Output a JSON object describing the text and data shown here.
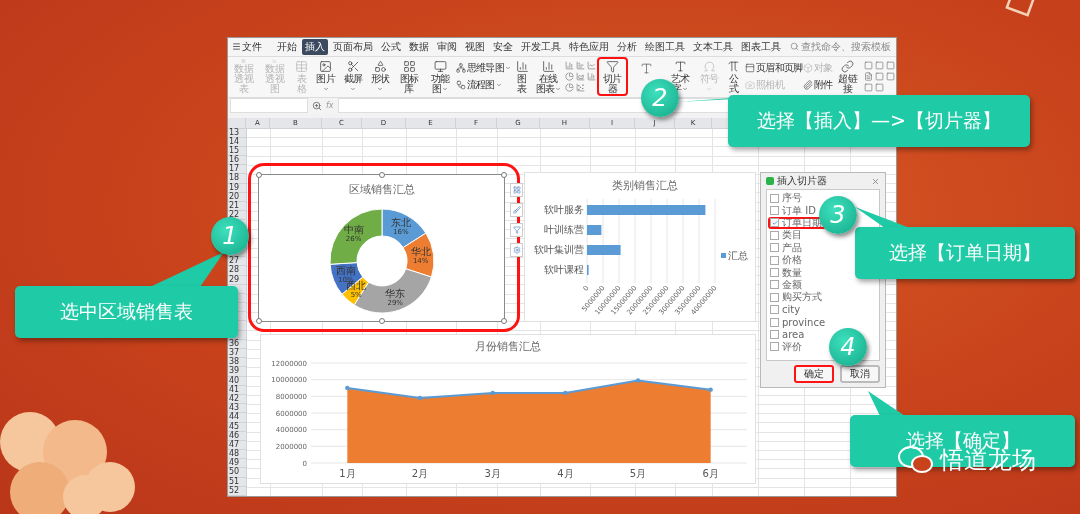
{
  "app": {
    "menu_label": "文件",
    "tabs": [
      {
        "label": "开始",
        "selected": false
      },
      {
        "label": "插入",
        "selected": true
      },
      {
        "label": "页面布局",
        "selected": false
      },
      {
        "label": "公式",
        "selected": false
      },
      {
        "label": "数据",
        "selected": false
      },
      {
        "label": "审阅",
        "selected": false
      },
      {
        "label": "视图",
        "selected": false
      },
      {
        "label": "安全",
        "selected": false
      },
      {
        "label": "开发工具",
        "selected": false
      },
      {
        "label": "特色应用",
        "selected": false
      },
      {
        "label": "分析",
        "selected": false
      },
      {
        "label": "绘图工具",
        "selected": false
      },
      {
        "label": "文本工具",
        "selected": false
      },
      {
        "label": "图表工具",
        "selected": false
      }
    ],
    "search": {
      "placeholder": "查找命令、搜索模板"
    },
    "ribbon": [
      {
        "kind": "large",
        "label": "数据透视表",
        "disabled": true,
        "dropdown": false,
        "highlighted": false
      },
      {
        "kind": "large",
        "label": "数据透视图",
        "disabled": true,
        "dropdown": false,
        "highlighted": false
      },
      {
        "kind": "large",
        "label": "表格",
        "disabled": true,
        "dropdown": false,
        "highlighted": false
      },
      {
        "kind": "large",
        "label": "图片",
        "disabled": false,
        "dropdown": true,
        "highlighted": false
      },
      {
        "kind": "large",
        "label": "截屏",
        "disabled": false,
        "dropdown": true,
        "highlighted": false
      },
      {
        "kind": "large",
        "label": "形状",
        "disabled": false,
        "dropdown": true,
        "highlighted": false
      },
      {
        "kind": "large",
        "label": "图标库",
        "disabled": false,
        "dropdown": false,
        "highlighted": false
      },
      {
        "kind": "large",
        "label": "功能图",
        "disabled": false,
        "dropdown": true,
        "highlighted": false
      },
      {
        "kind": "stack",
        "items": [
          {
            "label": "思维导图",
            "disabled": false,
            "dropdown": true
          },
          {
            "label": "流程图",
            "disabled": false,
            "dropdown": true
          }
        ]
      },
      {
        "kind": "large",
        "label": "图表",
        "disabled": false,
        "dropdown": false,
        "highlighted": false
      },
      {
        "kind": "large",
        "label": "在线图表",
        "disabled": false,
        "dropdown": true,
        "highlighted": false
      },
      {
        "kind": "icon_grid"
      },
      {
        "kind": "large",
        "label": "切片器",
        "disabled": false,
        "dropdown": false,
        "highlighted": true
      },
      {
        "kind": "icon_button"
      },
      {
        "kind": "large",
        "label": "艺术字",
        "disabled": false,
        "dropdown": true,
        "highlighted": false
      },
      {
        "kind": "large",
        "label": "符号",
        "disabled": true,
        "dropdown": true,
        "highlighted": false
      },
      {
        "kind": "large",
        "label": "公式",
        "disabled": false,
        "dropdown": false,
        "highlighted": false
      },
      {
        "kind": "stack",
        "items": [
          {
            "label": "页眉和页脚",
            "disabled": false,
            "dropdown": false
          },
          {
            "label": "照相机",
            "disabled": true,
            "dropdown": false
          }
        ]
      },
      {
        "kind": "stack",
        "items": [
          {
            "label": "对象",
            "disabled": true,
            "dropdown": false
          },
          {
            "label": "附件",
            "disabled": false,
            "dropdown": false
          }
        ]
      },
      {
        "kind": "large",
        "label": "超链接",
        "disabled": false,
        "dropdown": false,
        "highlighted": false
      },
      {
        "kind": "icon_grid"
      }
    ],
    "formula_bar": {
      "fx_label": "fx"
    },
    "columns": [
      "A",
      "B",
      "C",
      "D",
      "E",
      "F",
      "G",
      "H",
      "I",
      "J",
      "K"
    ],
    "rows": [
      "13",
      "14",
      "15",
      "16",
      "17",
      "18",
      "19",
      "20",
      "21",
      "22",
      null,
      null,
      null,
      null,
      "27",
      "28",
      "29",
      null,
      null,
      null,
      null,
      null,
      null,
      "36",
      "37",
      "38",
      "39",
      "40",
      "41",
      "42",
      "43",
      "44",
      "45",
      "46",
      "47",
      "48",
      "49",
      "50",
      "51",
      "52"
    ],
    "donut": {
      "highlighted": true,
      "chart_data": {
        "type": "donut",
        "title": "区域销售汇总",
        "categories": [
          "东北",
          "华北",
          "华东",
          "西北",
          "西南",
          "中南"
        ],
        "values": [
          16,
          14,
          29,
          5,
          10,
          26
        ],
        "value_labels": [
          "16%",
          "14%",
          "29%",
          "5%",
          "10%",
          "26%"
        ]
      }
    },
    "bar": {
      "chart_data": {
        "type": "bar",
        "orientation": "horizontal",
        "title": "类别销售汇总",
        "categories": [
          "软叶服务",
          "叶训练营",
          "软叶集训营",
          "软叶课程"
        ],
        "series": [
          {
            "name": "汇总",
            "color": "#5b9bd5",
            "values": [
              37000000,
              4500000,
              10500000,
              500000
            ]
          }
        ],
        "xlim": [
          0,
          40000000
        ],
        "grid": true,
        "xticks": [
          0,
          5000000,
          10000000,
          15000000,
          20000000,
          25000000,
          30000000,
          35000000,
          40000000
        ]
      }
    },
    "area": {
      "chart_data": {
        "type": "area",
        "title": "月份销售汇总",
        "categories": [
          "1月",
          "2月",
          "3月",
          "4月",
          "5月",
          "6月"
        ],
        "series": [
          {
            "type": "area",
            "color": "#ed7d31",
            "values": [
              9000000,
              7800000,
              8400000,
              8400000,
              9900000,
              8800000
            ]
          },
          {
            "type": "line",
            "color": "#5b9bd5",
            "values": [
              9000000,
              7800000,
              8400000,
              8400000,
              9900000,
              8800000
            ]
          }
        ],
        "ylim": [
          0,
          12000000
        ],
        "grid": true,
        "yticks": [
          0,
          2000000,
          4000000,
          6000000,
          8000000,
          10000000,
          12000000
        ]
      }
    },
    "dialog": {
      "title": "插入切片器",
      "fields": [
        {
          "label": "序号",
          "checked": false,
          "highlighted": false
        },
        {
          "label": "订单 ID",
          "checked": false,
          "highlighted": false
        },
        {
          "label": "订单日期",
          "checked": true,
          "highlighted": true
        },
        {
          "label": "类目",
          "checked": false,
          "highlighted": false
        },
        {
          "label": "产品",
          "checked": false,
          "highlighted": false
        },
        {
          "label": "价格",
          "checked": false,
          "highlighted": false
        },
        {
          "label": "数量",
          "checked": false,
          "highlighted": false
        },
        {
          "label": "金额",
          "checked": false,
          "highlighted": false
        },
        {
          "label": "购买方式",
          "checked": false,
          "highlighted": false
        },
        {
          "label": "city",
          "checked": false,
          "highlighted": false
        },
        {
          "label": "province",
          "checked": false,
          "highlighted": false
        },
        {
          "label": "area",
          "checked": false,
          "highlighted": false
        },
        {
          "label": "评价",
          "checked": false,
          "highlighted": false
        }
      ],
      "buttons": [
        {
          "label": "确定",
          "highlighted": true
        },
        {
          "label": "取消",
          "highlighted": false
        }
      ]
    }
  },
  "callouts": [
    {
      "number": "1",
      "text": "选中区域销售表"
    },
    {
      "number": "2",
      "text": "选择【插入】—>【切片器】"
    },
    {
      "number": "3",
      "text": "选择【订单日期】"
    },
    {
      "number": "4",
      "text": "选择【确定】"
    }
  ],
  "logo": {
    "text": "悟道龙场"
  }
}
